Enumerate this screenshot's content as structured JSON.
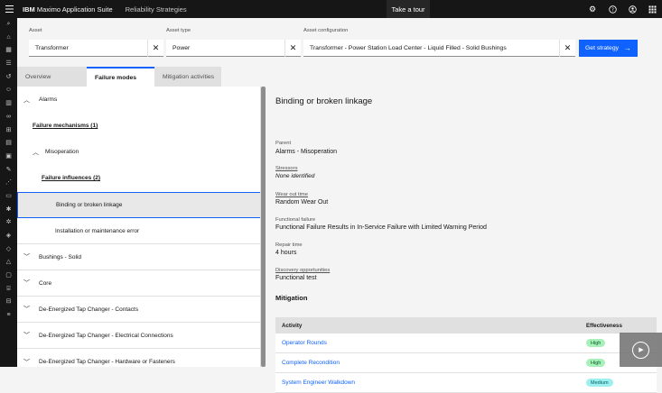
{
  "topbar": {
    "menu_icon": "hamburger-icon",
    "brand_bold": "IBM",
    "brand_rest": " Maximo Application Suite",
    "app_name": "Reliability Strategies",
    "tour_label": "Take a tour",
    "icons": [
      "gear-icon",
      "help-icon",
      "user-icon",
      "apps-icon"
    ]
  },
  "sidenav": {
    "icons": [
      "search-icon",
      "home-icon",
      "grid-icon",
      "list-icon",
      "history-icon",
      "users-icon",
      "chart-icon",
      "link-icon",
      "cart-icon",
      "document-icon",
      "calendar-icon",
      "tool-icon",
      "analytics-icon",
      "folder-icon",
      "settings-icon",
      "star-icon",
      "alert-icon",
      "shield-icon",
      "warning-icon",
      "box-icon",
      "store-icon",
      "cart-icon-2",
      "more-icon"
    ]
  },
  "filters": {
    "asset": {
      "label": "Asset",
      "value": "Transformer"
    },
    "asset_type": {
      "label": "Asset type",
      "value": "Power"
    },
    "asset_config": {
      "label": "Asset configuration",
      "value": "Transformer - Power Station Load Center - Liquid Filled - Solid Bushings"
    },
    "get_strategy": "Get strategy"
  },
  "tabs": [
    {
      "label": "Overview"
    },
    {
      "label": "Failure modes"
    },
    {
      "label": "Mitigation activities"
    }
  ],
  "tree": {
    "alarms": "Alarms",
    "failure_mechanisms": "Failure mechanisms (1)",
    "misoperation": "Misoperation",
    "failure_influences": "Failure influences (2)",
    "binding": "Binding or broken linkage",
    "installation": "Installation or maintenance error",
    "bushings": "Bushings - Solid",
    "core": "Core",
    "detc_contacts": "De-Energized Tap Changer - Contacts",
    "detc_electrical": "De-Energized Tap Changer - Electrical Connections",
    "detc_hardware": "De-Energized Tap Changer - Hardware or Fasteners"
  },
  "detail": {
    "title": "Binding or broken linkage",
    "parent_label": "Parent",
    "parent_value": "Alarms - Misoperation",
    "stressors_label": "Stressors",
    "stressors_value": "None identified",
    "wearout_label": "Wear out time",
    "wearout_value": "Random Wear Out",
    "functional_label": "Functional failure",
    "functional_value": "Functional Failure Results in In-Service Failure with Limited Warning Period",
    "repair_label": "Repair time",
    "repair_value": "4 hours",
    "discovery_label": "Discovery opportunities",
    "discovery_value": "Functional test"
  },
  "mitigation": {
    "title": "Mitigation",
    "col_activity": "Activity",
    "col_effectiveness": "Effectiveness",
    "rows": [
      {
        "activity": "Operator Rounds",
        "effectiveness": "High"
      },
      {
        "activity": "Complete Recondition",
        "effectiveness": "High"
      },
      {
        "activity": "System Engineer Walkdown",
        "effectiveness": "Medium"
      }
    ],
    "colors": {
      "high_bg": "#a7f0ba",
      "high_fg": "#0e6027",
      "medium_bg": "#9ef0f0",
      "medium_fg": "#005d5d"
    }
  },
  "video_overlay": {
    "icon": "play-icon"
  }
}
